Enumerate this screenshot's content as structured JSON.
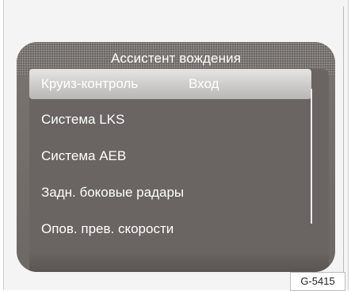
{
  "screen": {
    "title": "Ассистент вождения",
    "menu": [
      {
        "label": "Круиз-контроль",
        "value": "Вход",
        "selected": true
      },
      {
        "label": "Система LKS"
      },
      {
        "label": "Система AEB"
      },
      {
        "label": "Задн. боковые радары"
      },
      {
        "label": "Опов. прев. скорости"
      }
    ]
  },
  "figure_code": "G-5415",
  "colors": {
    "screen_bg": "#6d6865",
    "selected_bg": "#cfcdcc",
    "text": "#ffffff"
  }
}
